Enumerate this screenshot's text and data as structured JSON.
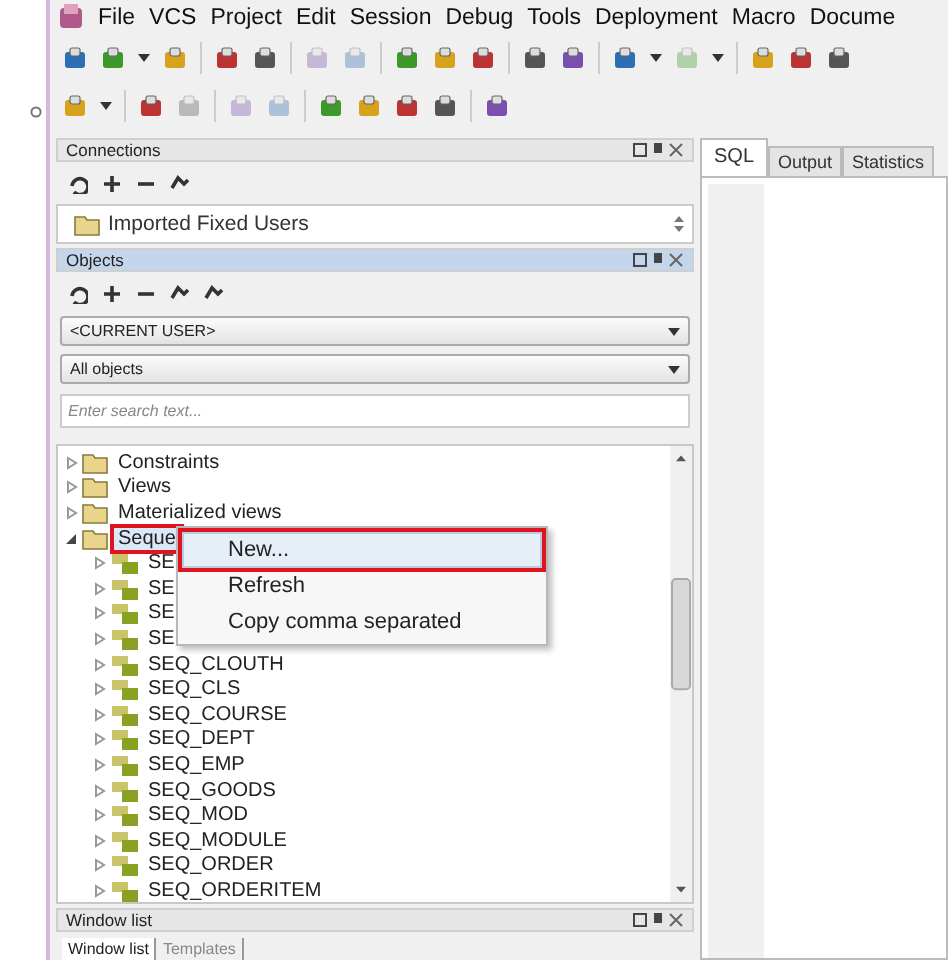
{
  "menu": [
    "File",
    "VCS",
    "Project",
    "Edit",
    "Session",
    "Debug",
    "Tools",
    "Deployment",
    "Macro",
    "Docume"
  ],
  "connections": {
    "title": "Connections",
    "active": false,
    "items": [
      "Imported Fixed Users"
    ]
  },
  "objects": {
    "title": "Objects",
    "active": true,
    "user_select": "<CURRENT USER>",
    "filter_select": "All objects",
    "search": {
      "placeholder": "Enter search text..."
    },
    "tree": [
      {
        "label": "Constraints",
        "expanded": false,
        "selected": false,
        "annotated": false
      },
      {
        "label": "Views",
        "expanded": false,
        "selected": false,
        "annotated": false
      },
      {
        "label": "Materialized views",
        "expanded": false,
        "selected": false,
        "annotated": false
      },
      {
        "label": "Seque",
        "expanded": true,
        "selected": true,
        "annotated": true,
        "children": [
          {
            "label": "SE"
          },
          {
            "label": "SE"
          },
          {
            "label": "SE"
          },
          {
            "label": "SE"
          },
          {
            "label": "SEQ_CLOUTH"
          },
          {
            "label": "SEQ_CLS"
          },
          {
            "label": "SEQ_COURSE"
          },
          {
            "label": "SEQ_DEPT"
          },
          {
            "label": "SEQ_EMP"
          },
          {
            "label": "SEQ_GOODS"
          },
          {
            "label": "SEQ_MOD"
          },
          {
            "label": "SEQ_MODULE"
          },
          {
            "label": "SEQ_ORDER"
          },
          {
            "label": "SEQ_ORDERITEM"
          }
        ]
      }
    ]
  },
  "context_menu": [
    {
      "label": "New...",
      "selected": true,
      "annotated": true
    },
    {
      "label": "Refresh",
      "selected": false,
      "annotated": false
    },
    {
      "label": "Copy comma separated",
      "selected": false,
      "annotated": false
    }
  ],
  "editor_tabs": [
    {
      "label": "SQL",
      "selected": true
    },
    {
      "label": "Output",
      "selected": false
    },
    {
      "label": "Statistics",
      "selected": false
    }
  ],
  "window_list": {
    "title": "Window list",
    "active": false,
    "tabs": [
      {
        "label": "Window list",
        "selected": true
      },
      {
        "label": "Templates",
        "selected": false
      }
    ]
  }
}
